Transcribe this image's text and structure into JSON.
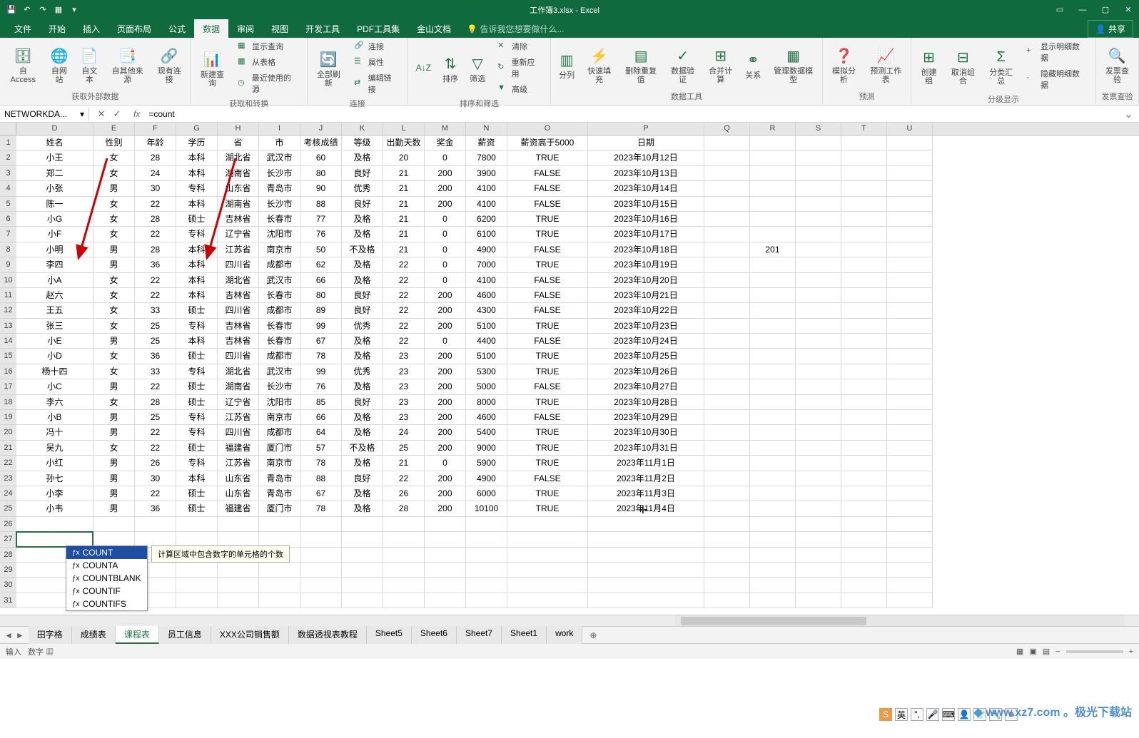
{
  "titlebar": {
    "title": "工作簿3.xlsx - Excel",
    "share": "共享"
  },
  "tabs": {
    "file": "文件",
    "home": "开始",
    "insert": "插入",
    "layout": "页面布局",
    "formula": "公式",
    "data": "数据",
    "review": "审阅",
    "view": "视图",
    "dev": "开发工具",
    "pdf": "PDF工具集",
    "wps": "金山文档",
    "tell": "告诉我您想要做什么..."
  },
  "ribbon": {
    "ext_data": {
      "access": "自 Access",
      "web": "自网站",
      "text": "自文本",
      "other": "自其他来源",
      "existing": "现有连接",
      "label": "获取外部数据"
    },
    "get_transform": {
      "new_query": "新建查询",
      "show_query": "显示查询",
      "from_table": "从表格",
      "recent": "最近使用的源",
      "label": "获取和转换"
    },
    "connections": {
      "refresh": "全部刷新",
      "conn": "连接",
      "props": "属性",
      "edit_links": "编辑链接",
      "label": "连接"
    },
    "sort_filter": {
      "sort": "排序",
      "filter": "筛选",
      "clear": "清除",
      "reapply": "重新应用",
      "advanced": "高级",
      "label": "排序和筛选"
    },
    "data_tools": {
      "text_col": "分列",
      "flash": "快速填充",
      "remove_dup": "删除重复值",
      "validation": "数据验证",
      "consolidate": "合并计算",
      "relations": "关系",
      "manage_model": "管理数据模型",
      "label": "数据工具"
    },
    "forecast": {
      "whatif": "模拟分析",
      "sheet": "预测工作表",
      "label": "预测"
    },
    "outline": {
      "group": "创建组",
      "ungroup": "取消组合",
      "subtotal": "分类汇总",
      "show": "显示明细数据",
      "hide": "隐藏明细数据",
      "label": "分级显示"
    },
    "invoice": {
      "check": "发票查验",
      "label": "发票查验"
    }
  },
  "namebox": "NETWORKDA...",
  "formula": "=count",
  "col_headers": [
    "D",
    "E",
    "F",
    "G",
    "H",
    "I",
    "J",
    "K",
    "L",
    "M",
    "N",
    "O",
    "P",
    "Q",
    "R",
    "S",
    "T",
    "U"
  ],
  "table": {
    "headers": [
      "姓名",
      "性别",
      "年龄",
      "学历",
      "省",
      "市",
      "考核成绩",
      "等级",
      "出勤天数",
      "奖金",
      "薪资",
      "薪资高于5000",
      "日期"
    ],
    "rows": [
      [
        "小王",
        "女",
        "28",
        "本科",
        "湖北省",
        "武汉市",
        "60",
        "及格",
        "20",
        "0",
        "7800",
        "TRUE",
        "2023年10月12日"
      ],
      [
        "郑二",
        "女",
        "24",
        "本科",
        "湖南省",
        "长沙市",
        "80",
        "良好",
        "21",
        "200",
        "3900",
        "FALSE",
        "2023年10月13日"
      ],
      [
        "小张",
        "男",
        "30",
        "专科",
        "山东省",
        "青岛市",
        "90",
        "优秀",
        "21",
        "200",
        "4100",
        "FALSE",
        "2023年10月14日"
      ],
      [
        "陈一",
        "女",
        "22",
        "本科",
        "湖南省",
        "长沙市",
        "88",
        "良好",
        "21",
        "200",
        "4100",
        "FALSE",
        "2023年10月15日"
      ],
      [
        "小G",
        "女",
        "28",
        "硕士",
        "吉林省",
        "长春市",
        "77",
        "及格",
        "21",
        "0",
        "6200",
        "TRUE",
        "2023年10月16日"
      ],
      [
        "小F",
        "女",
        "22",
        "专科",
        "辽宁省",
        "沈阳市",
        "76",
        "及格",
        "21",
        "0",
        "6100",
        "TRUE",
        "2023年10月17日"
      ],
      [
        "小明",
        "男",
        "28",
        "本科",
        "江苏省",
        "南京市",
        "50",
        "不及格",
        "21",
        "0",
        "4900",
        "FALSE",
        "2023年10月18日"
      ],
      [
        "李四",
        "男",
        "36",
        "本科",
        "四川省",
        "成都市",
        "62",
        "及格",
        "22",
        "0",
        "7000",
        "TRUE",
        "2023年10月19日"
      ],
      [
        "小A",
        "女",
        "22",
        "本科",
        "湖北省",
        "武汉市",
        "66",
        "及格",
        "22",
        "0",
        "4100",
        "FALSE",
        "2023年10月20日"
      ],
      [
        "赵六",
        "女",
        "22",
        "本科",
        "吉林省",
        "长春市",
        "80",
        "良好",
        "22",
        "200",
        "4600",
        "FALSE",
        "2023年10月21日"
      ],
      [
        "王五",
        "女",
        "33",
        "硕士",
        "四川省",
        "成都市",
        "89",
        "良好",
        "22",
        "200",
        "4300",
        "FALSE",
        "2023年10月22日"
      ],
      [
        "张三",
        "女",
        "25",
        "专科",
        "吉林省",
        "长春市",
        "99",
        "优秀",
        "22",
        "200",
        "5100",
        "TRUE",
        "2023年10月23日"
      ],
      [
        "小E",
        "男",
        "25",
        "本科",
        "吉林省",
        "长春市",
        "67",
        "及格",
        "22",
        "0",
        "4400",
        "FALSE",
        "2023年10月24日"
      ],
      [
        "小D",
        "女",
        "36",
        "硕士",
        "四川省",
        "成都市",
        "78",
        "及格",
        "23",
        "200",
        "5100",
        "TRUE",
        "2023年10月25日"
      ],
      [
        "杨十四",
        "女",
        "33",
        "专科",
        "湖北省",
        "武汉市",
        "99",
        "优秀",
        "23",
        "200",
        "5300",
        "TRUE",
        "2023年10月26日"
      ],
      [
        "小C",
        "男",
        "22",
        "硕士",
        "湖南省",
        "长沙市",
        "76",
        "及格",
        "23",
        "200",
        "5000",
        "FALSE",
        "2023年10月27日"
      ],
      [
        "李六",
        "女",
        "28",
        "硕士",
        "辽宁省",
        "沈阳市",
        "85",
        "良好",
        "23",
        "200",
        "8000",
        "TRUE",
        "2023年10月28日"
      ],
      [
        "小B",
        "男",
        "25",
        "专科",
        "江苏省",
        "南京市",
        "66",
        "及格",
        "23",
        "200",
        "4600",
        "FALSE",
        "2023年10月29日"
      ],
      [
        "冯十",
        "男",
        "22",
        "专科",
        "四川省",
        "成都市",
        "64",
        "及格",
        "24",
        "200",
        "5400",
        "TRUE",
        "2023年10月30日"
      ],
      [
        "吴九",
        "女",
        "22",
        "硕士",
        "福建省",
        "厦门市",
        "57",
        "不及格",
        "25",
        "200",
        "9000",
        "TRUE",
        "2023年10月31日"
      ],
      [
        "小红",
        "男",
        "26",
        "专科",
        "江苏省",
        "南京市",
        "78",
        "及格",
        "21",
        "0",
        "5900",
        "TRUE",
        "2023年11月1日"
      ],
      [
        "孙七",
        "男",
        "30",
        "本科",
        "山东省",
        "青岛市",
        "88",
        "良好",
        "22",
        "200",
        "4900",
        "FALSE",
        "2023年11月2日"
      ],
      [
        "小李",
        "男",
        "22",
        "硕士",
        "山东省",
        "青岛市",
        "67",
        "及格",
        "26",
        "200",
        "6000",
        "TRUE",
        "2023年11月3日"
      ],
      [
        "小韦",
        "男",
        "36",
        "硕士",
        "福建省",
        "厦门市",
        "78",
        "及格",
        "28",
        "200",
        "10100",
        "TRUE",
        "2023年11月4日"
      ]
    ]
  },
  "extra_cell": {
    "r_value": "201"
  },
  "active_formula": "=count",
  "suggestions": {
    "items": [
      "COUNT",
      "COUNTA",
      "COUNTBLANK",
      "COUNTIF",
      "COUNTIFS"
    ],
    "tip": "计算区域中包含数字的单元格的个数"
  },
  "sheets": {
    "tabs": [
      "田字格",
      "成绩表",
      "课程表",
      "员工信息",
      "XXX公司销售额",
      "数据透视表教程",
      "Sheet5",
      "Sheet6",
      "Sheet7",
      "Sheet1",
      "work"
    ],
    "active_idx": 2
  },
  "status": {
    "left1": "输入",
    "left2": "数字"
  },
  "watermark": "www.xz7.com 。极光下载站"
}
